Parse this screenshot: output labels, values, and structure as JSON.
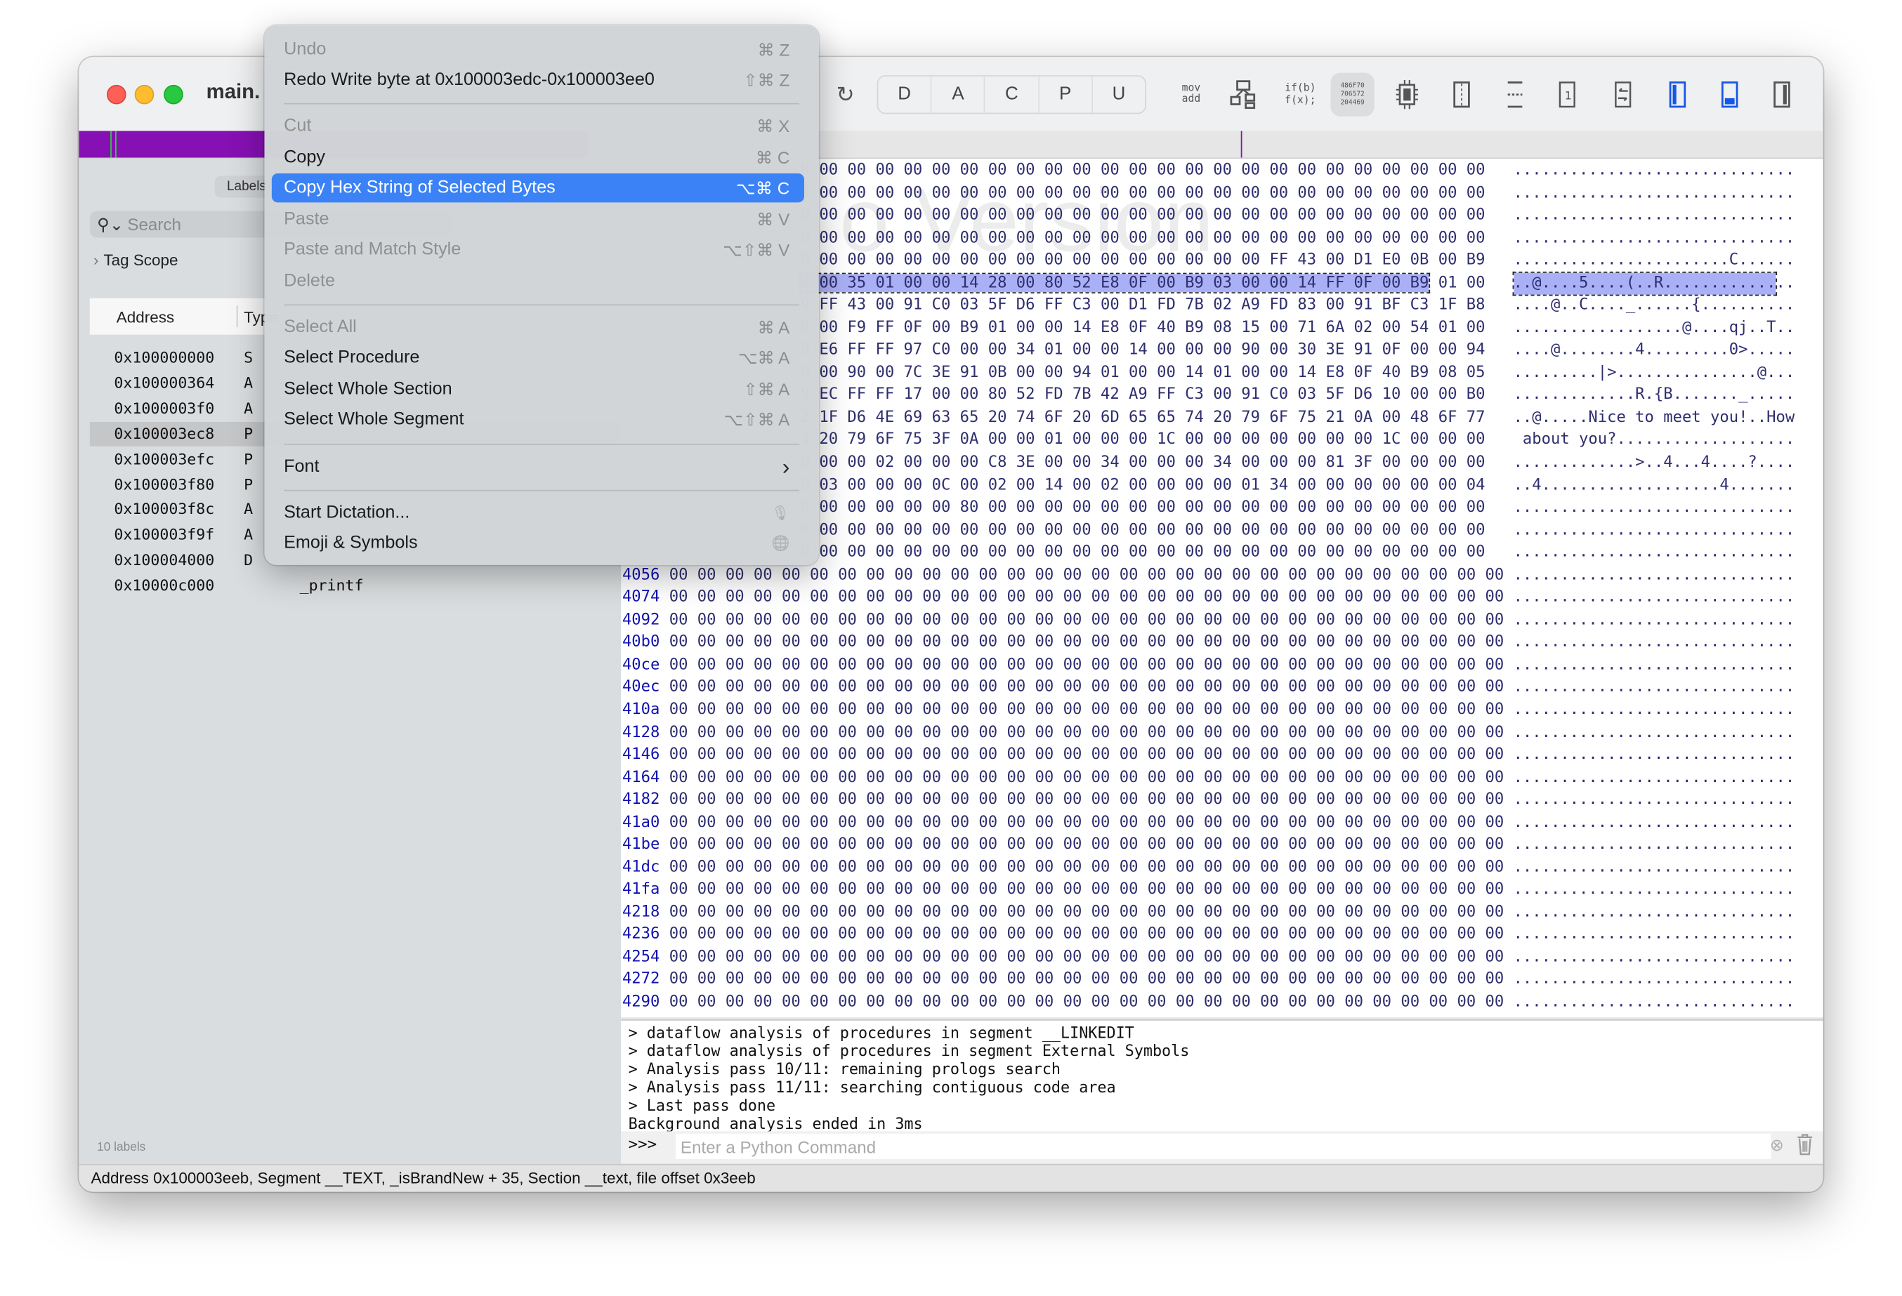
{
  "window": {
    "title": "main."
  },
  "toolbar": {
    "segments": [
      "D",
      "A",
      "C",
      "P",
      "U"
    ],
    "mov_add": [
      "mov",
      "add"
    ],
    "ifb_fx": [
      "if(b)",
      "f(x);"
    ],
    "hex_lines": [
      "486F70",
      "706572",
      "204469"
    ],
    "icons": [
      "refresh-icon",
      "control-flow-graph-icon",
      "pseudocode-icon",
      "hex-icon",
      "cpu-icon",
      "split-vertical-icon",
      "split-horizontal-icon",
      "single-view-icon",
      "swap-icon",
      "left-sidebar-icon",
      "bottom-panel-icon",
      "right-sidebar-icon"
    ],
    "active_color": "#1556e6"
  },
  "sidebar": {
    "tab": "Labels",
    "search_placeholder": "Search",
    "tag_scope": "Tag Scope",
    "columns": [
      "Address",
      "Type"
    ],
    "rows": [
      {
        "address": "0x100000000",
        "type": "S",
        "name": ""
      },
      {
        "address": "0x100000364",
        "type": "A",
        "name": ""
      },
      {
        "address": "0x1000003f0",
        "type": "A",
        "name": ""
      },
      {
        "address": "0x100003ec8",
        "type": "P",
        "name": "",
        "selected": true
      },
      {
        "address": "0x100003efc",
        "type": "P",
        "name": ""
      },
      {
        "address": "0x100003f80",
        "type": "P",
        "name": ""
      },
      {
        "address": "0x100003f8c",
        "type": "A",
        "name": ""
      },
      {
        "address": "0x100003f9f",
        "type": "A",
        "name": ""
      },
      {
        "address": "0x100004000",
        "type": "D",
        "name": ""
      },
      {
        "address": "0x10000c000",
        "type": "",
        "name": "_printf"
      }
    ],
    "count_label": "10 labels"
  },
  "hex": {
    "watermark": "o Version",
    "colors": {
      "address": "#1111b0",
      "bytes": "#2f2f6f",
      "selection": "#aab0f5"
    },
    "selection": {
      "row": 5,
      "last_byte_index": 27
    },
    "rows": [
      {
        "addr": "",
        "hex": "0 00 00 00 00 00 00 00 00 00 00 00 00 00 00 00 00 00 00 00 00 00 00 00 00",
        "ascii": ".............................."
      },
      {
        "addr": "",
        "hex": "0 00 00 00 00 00 00 00 00 00 00 00 00 00 00 00 00 00 00 00 00 00 00 00 00",
        "ascii": ".............................."
      },
      {
        "addr": "",
        "hex": "0 00 00 00 00 00 00 00 00 00 00 00 00 00 00 00 00 00 00 00 00 00 00 00 00",
        "ascii": ".............................."
      },
      {
        "addr": "",
        "hex": "0 00 00 00 00 00 00 00 00 00 00 00 00 00 00 00 00 00 00 00 00 00 00 00 00",
        "ascii": ".............................."
      },
      {
        "addr": "",
        "hex": "0 00 00 00 00 00 00 00 00 00 00 00 00 00 00 00 00 FF 43 00 D1 E0 0B 00 B9",
        "ascii": ".......................C......"
      },
      {
        "addr": "",
        "hex": "0 00 35 01 00 00 14 28 00 80 52 E8 0F 00 B9 03 00 00 14 FF 0F 00 B9 01 00",
        "ascii": "..@....5....(..R.............."
      },
      {
        "addr": "",
        "hex": "9 FF 43 00 91 C0 03 5F D6 FF C3 00 D1 FD 7B 02 A9 FD 83 00 91 BF C3 1F B8",
        "ascii": "....@..C...._......{.........."
      },
      {
        "addr": "",
        "hex": "B 00 F9 FF 0F 00 B9 01 00 00 14 E8 0F 40 B9 08 15 00 71 6A 02 00 54 01 00",
        "ascii": "..................@....qj..T.."
      },
      {
        "addr": "",
        "hex": "9 E6 FF FF 97 C0 00 00 34 01 00 00 14 00 00 00 90 00 30 3E 91 0F 00 00 94",
        "ascii": "....@........4.........0>....."
      },
      {
        "addr": "",
        "hex": "0 00 90 00 7C 3E 91 0B 00 00 94 01 00 00 14 01 00 00 14 E8 0F 40 B9 08 05",
        "ascii": ".........|>...............@..."
      },
      {
        "addr": "",
        "hex": "9 EC FF FF 17 00 00 80 52 FD 7B 42 A9 FF C3 00 91 C0 03 5F D6 10 00 00 B0",
        "ascii": ".............R.{B......._....."
      },
      {
        "addr": "",
        "hex": "2 1F D6 4E 69 63 65 20 74 6F 20 6D 65 65 74 20 79 6F 75 21 0A 00 48 6F 77",
        "ascii": "..@.....Nice to meet you!..How"
      },
      {
        "addr": "",
        "hex": "4 20 79 6F 75 3F 0A 00 00 01 00 00 00 1C 00 00 00 00 00 00 00 1C 00 00 00",
        "ascii": " about you?..................."
      },
      {
        "addr": "",
        "hex": "0 00 00 02 00 00 00 C8 3E 00 00 34 00 00 00 34 00 00 00 81 3F 00 00 00 00",
        "ascii": ".............>..4...4....?...."
      },
      {
        "addr": "",
        "hex": "0 03 00 00 00 0C 00 02 00 14 00 02 00 00 00 00 01 34 00 00 00 00 00 00 04",
        "ascii": "..4...................4......."
      },
      {
        "addr": "",
        "hex": "0 00 00 00 00 00 80 00 00 00 00 00 00 00 00 00 00 00 00 00 00 00 00 00 00",
        "ascii": ".............................."
      },
      {
        "addr": "",
        "hex": "0 00 00 00 00 00 00 00 00 00 00 00 00 00 00 00 00 00 00 00 00 00 00 00 00",
        "ascii": ".............................."
      },
      {
        "addr": "",
        "hex": "0 00 00 00 00 00 00 00 00 00 00 00 00 00 00 00 00 00 00 00 00 00 00 00 00",
        "ascii": ".............................."
      },
      {
        "addr": "4056",
        "zero": true
      },
      {
        "addr": "4074",
        "zero": true
      },
      {
        "addr": "4092",
        "zero": true
      },
      {
        "addr": "40b0",
        "zero": true
      },
      {
        "addr": "40ce",
        "zero": true
      },
      {
        "addr": "40ec",
        "zero": true
      },
      {
        "addr": "410a",
        "zero": true
      },
      {
        "addr": "4128",
        "zero": true
      },
      {
        "addr": "4146",
        "zero": true
      },
      {
        "addr": "4164",
        "zero": true
      },
      {
        "addr": "4182",
        "zero": true
      },
      {
        "addr": "41a0",
        "zero": true
      },
      {
        "addr": "41be",
        "zero": true
      },
      {
        "addr": "41dc",
        "zero": true
      },
      {
        "addr": "41fa",
        "zero": true
      },
      {
        "addr": "4218",
        "zero": true
      },
      {
        "addr": "4236",
        "zero": true
      },
      {
        "addr": "4254",
        "zero": true
      },
      {
        "addr": "4272",
        "zero": true
      },
      {
        "addr": "4290",
        "zero": true
      }
    ]
  },
  "console": {
    "lines": [
      "> dataflow analysis of procedures in segment __LINKEDIT",
      "> dataflow analysis of procedures in segment External Symbols",
      "> Analysis pass 10/11: remaining prologs search",
      "> Analysis pass 11/11: searching contiguous code area",
      "> Last pass done",
      "Background analysis ended in 3ms"
    ],
    "prompt": ">>>",
    "input_placeholder": "Enter a Python Command",
    "input_value": ""
  },
  "status_bar": {
    "text": "Address 0x100003eeb, Segment __TEXT, _isBrandNew + 35, Section __text, file offset 0x3eeb"
  },
  "context_menu": {
    "items": [
      {
        "label": "Undo",
        "shortcut": "⌘ Z",
        "disabled": true
      },
      {
        "label": "Redo Write byte at 0x100003edc-0x100003ee0",
        "shortcut": "⇧⌘ Z"
      },
      {
        "sep": true
      },
      {
        "label": "Cut",
        "shortcut": "⌘ X",
        "disabled": true
      },
      {
        "label": "Copy",
        "shortcut": "⌘ C"
      },
      {
        "label": "Copy Hex String of Selected Bytes",
        "shortcut": "⌥⌘ C",
        "highlighted": true
      },
      {
        "label": "Paste",
        "shortcut": "⌘ V",
        "disabled": true
      },
      {
        "label": "Paste and Match Style",
        "shortcut": "⌥⇧⌘ V",
        "disabled": true
      },
      {
        "label": "Delete",
        "shortcut": "",
        "disabled": true
      },
      {
        "sep": true
      },
      {
        "label": "Select All",
        "shortcut": "⌘ A",
        "disabled": true
      },
      {
        "label": "Select Procedure",
        "shortcut": "⌥⌘ A"
      },
      {
        "label": "Select Whole Section",
        "shortcut": "⇧⌘ A"
      },
      {
        "label": "Select Whole Segment",
        "shortcut": "⌥⇧⌘ A"
      },
      {
        "sep": true
      },
      {
        "label": "Font",
        "shortcut": "›",
        "submenu": true
      },
      {
        "sep": true
      },
      {
        "label": "Start Dictation...",
        "shortcut": "🎙"
      },
      {
        "label": "Emoji & Symbols",
        "shortcut": "🌐"
      }
    ]
  }
}
